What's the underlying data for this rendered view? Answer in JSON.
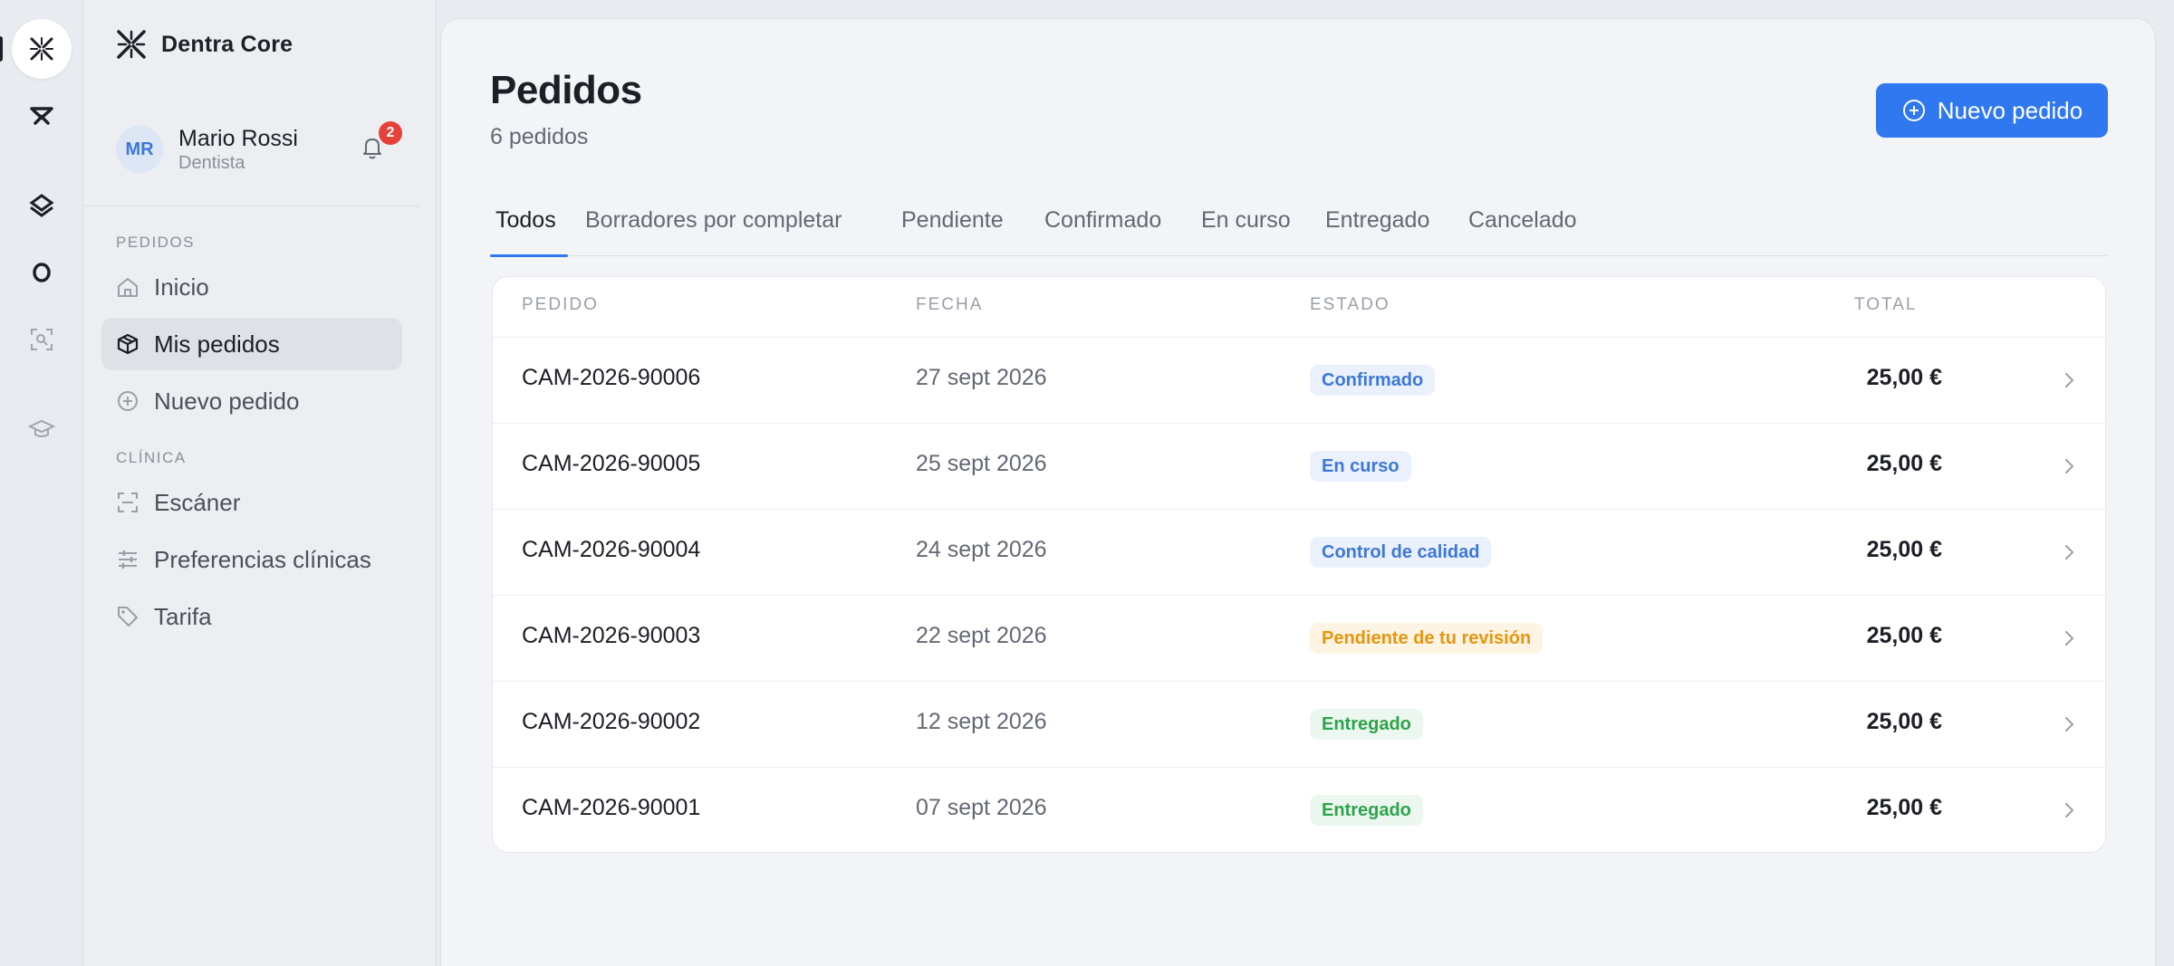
{
  "brand": {
    "name": "Dentra Core"
  },
  "user": {
    "initials": "MR",
    "name": "Mario Rossi",
    "role": "Dentista",
    "notifications": "2"
  },
  "rail": [
    {
      "icon": "dentra-logo-icon"
    },
    {
      "icon": "app-2-icon"
    },
    {
      "icon": "app-3-icon"
    },
    {
      "icon": "app-4-icon"
    },
    {
      "icon": "scan-icon"
    },
    {
      "icon": "graduation-cap-icon"
    }
  ],
  "sidebar": {
    "section_orders": "PEDIDOS",
    "section_clinic": "CLÍNICA",
    "items": [
      {
        "label": "Inicio",
        "icon": "home-icon"
      },
      {
        "label": "Mis pedidos",
        "icon": "box-icon",
        "active": true
      },
      {
        "label": "Nuevo pedido",
        "icon": "plus-circle-icon"
      },
      {
        "label": "Escáner",
        "icon": "scan-icon"
      },
      {
        "label": "Preferencias clínicas",
        "icon": "sliders-icon"
      },
      {
        "label": "Tarifa",
        "icon": "tag-icon"
      }
    ]
  },
  "main": {
    "title": "Pedidos",
    "count": "6 pedidos",
    "new_order_label": "Nuevo pedido",
    "tabs": [
      {
        "label": "Todos",
        "active": true
      },
      {
        "label": "Borradores por completar"
      },
      {
        "label": "Pendiente"
      },
      {
        "label": "Confirmado"
      },
      {
        "label": "En curso"
      },
      {
        "label": "Entregado"
      },
      {
        "label": "Cancelado"
      }
    ],
    "columns": [
      "PEDIDO",
      "FECHA",
      "ESTADO",
      "TOTAL"
    ],
    "rows": [
      {
        "id": "CAM-2026-90006",
        "date": "27 sept 2026",
        "status": "Confirmado",
        "status_color": "#3d78d8",
        "total": "25,00 €"
      },
      {
        "id": "CAM-2026-90005",
        "date": "25 sept 2026",
        "status": "En curso",
        "status_color": "#3d78d8",
        "total": "25,00 €"
      },
      {
        "id": "CAM-2026-90004",
        "date": "24 sept 2026",
        "status": "Control de calidad",
        "status_color": "#3d78d8",
        "total": "25,00 €"
      },
      {
        "id": "CAM-2026-90003",
        "date": "22 sept 2026",
        "status": "Pendiente de tu revisión",
        "status_color": "#e8950e",
        "total": "25,00 €"
      },
      {
        "id": "CAM-2026-90002",
        "date": "12 sept 2026",
        "status": "Entregado",
        "status_color": "#2ea34c",
        "total": "25,00 €"
      },
      {
        "id": "CAM-2026-90001",
        "date": "07 sept 2026",
        "status": "Entregado",
        "status_color": "#2ea34c",
        "total": "25,00 €"
      }
    ]
  },
  "colors": {
    "accent": "#2f78ef",
    "badge_alert": "#e5413a"
  }
}
